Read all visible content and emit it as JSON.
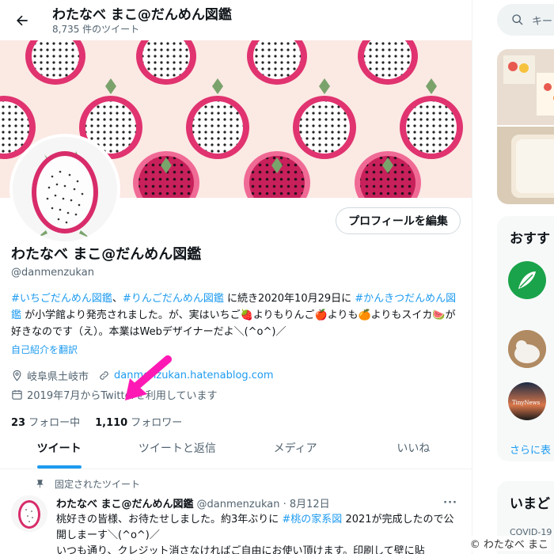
{
  "header": {
    "name": "わたなべ まこ@だんめん図鑑",
    "tweet_count": "8,735 件のツイート"
  },
  "profile": {
    "edit_button": "プロフィールを編集",
    "name": "わたなべ まこ@だんめん図鑑",
    "handle": "@danmenzukan",
    "bio": {
      "tag1": "#いちごだんめん図鑑",
      "sep1": "、",
      "tag2": "#りんごだんめん図鑑",
      "text1": " に続き2020年10月29日に ",
      "tag3": "#かんきつだんめん図鑑",
      "text2": " が小学館より発売されました。が、実はいちご🍓よりもりんご🍎よりも🍊よりもスイカ🍉が好きなのです（え）。本業はWebデザイナーだよ＼(^o^)／"
    },
    "translate_link": "自己紹介を翻訳",
    "location": "岐阜県土岐市",
    "website": "danmenzukan.hatenablog.com",
    "joined": "2019年7月からTwitterを利用しています",
    "following_count": "23",
    "following_label": "フォロー中",
    "followers_count": "1,110",
    "followers_label": "フォロワー"
  },
  "tabs": [
    {
      "label": "ツイート",
      "active": true
    },
    {
      "label": "ツイートと返信",
      "active": false
    },
    {
      "label": "メディア",
      "active": false
    },
    {
      "label": "いいね",
      "active": false
    }
  ],
  "pinned": {
    "label": "固定されたツイート",
    "name": "わたなべ まこ@だんめん図鑑",
    "handle_date": "@danmenzukan · 8月12日",
    "more": "···",
    "text1": "桃好きの皆様、お待たせしました。約3年ぶりに ",
    "tag": "#桃の家系図",
    "text2": " 2021が完成したので公開しまーす＼(^o^)／",
    "text3": "いつも通り、クレジット消さなければご自由にお使い頂けます。印刷して壁に貼"
  },
  "sidebar": {
    "search_placeholder": "キー",
    "follow_title": "おすす",
    "more_link": "さらに表",
    "trend_title": "いまど",
    "trend_item": "COVID-19",
    "avatar3_label": "TinyNews"
  },
  "watermark": "© わたなべ まこ",
  "colors": {
    "accent": "#1d9bf0",
    "pink_arrow": "#ff19b4",
    "dragon_fruit": "#e0336f"
  }
}
